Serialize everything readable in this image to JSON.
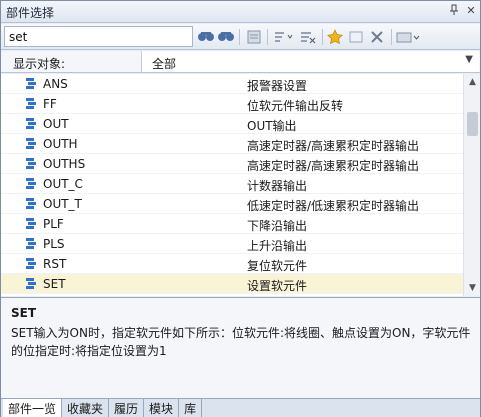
{
  "window": {
    "title": "部件选择"
  },
  "toolbar": {
    "search_value": "set"
  },
  "filter": {
    "label": "显示对象:",
    "value": "全部"
  },
  "items": [
    {
      "name": "ANS",
      "desc": "报警器设置"
    },
    {
      "name": "FF",
      "desc": "位软元件输出反转"
    },
    {
      "name": "OUT",
      "desc": "OUT输出"
    },
    {
      "name": "OUTH",
      "desc": "高速定时器/高速累积定时器输出"
    },
    {
      "name": "OUTHS",
      "desc": "高速定时器/高速累积定时器输出"
    },
    {
      "name": "OUT_C",
      "desc": "计数器输出"
    },
    {
      "name": "OUT_T",
      "desc": "低速定时器/低速累积定时器输出"
    },
    {
      "name": "PLF",
      "desc": "下降沿输出"
    },
    {
      "name": "PLS",
      "desc": "上升沿输出"
    },
    {
      "name": "RST",
      "desc": "复位软元件"
    },
    {
      "name": "SET",
      "desc": "设置软元件"
    }
  ],
  "selected_index": 10,
  "detail": {
    "title": "SET",
    "text": "SET输入为ON时，指定软元件如下所示：位软元件:将线圈、触点设置为ON，字软元件的位指定时:将指定位设置为1"
  },
  "tabs": [
    "部件一览",
    "收藏夹",
    "履历",
    "模块",
    "库"
  ],
  "colors": {
    "icon": "#2f6fd6",
    "selected_row": "#faf4d6"
  }
}
